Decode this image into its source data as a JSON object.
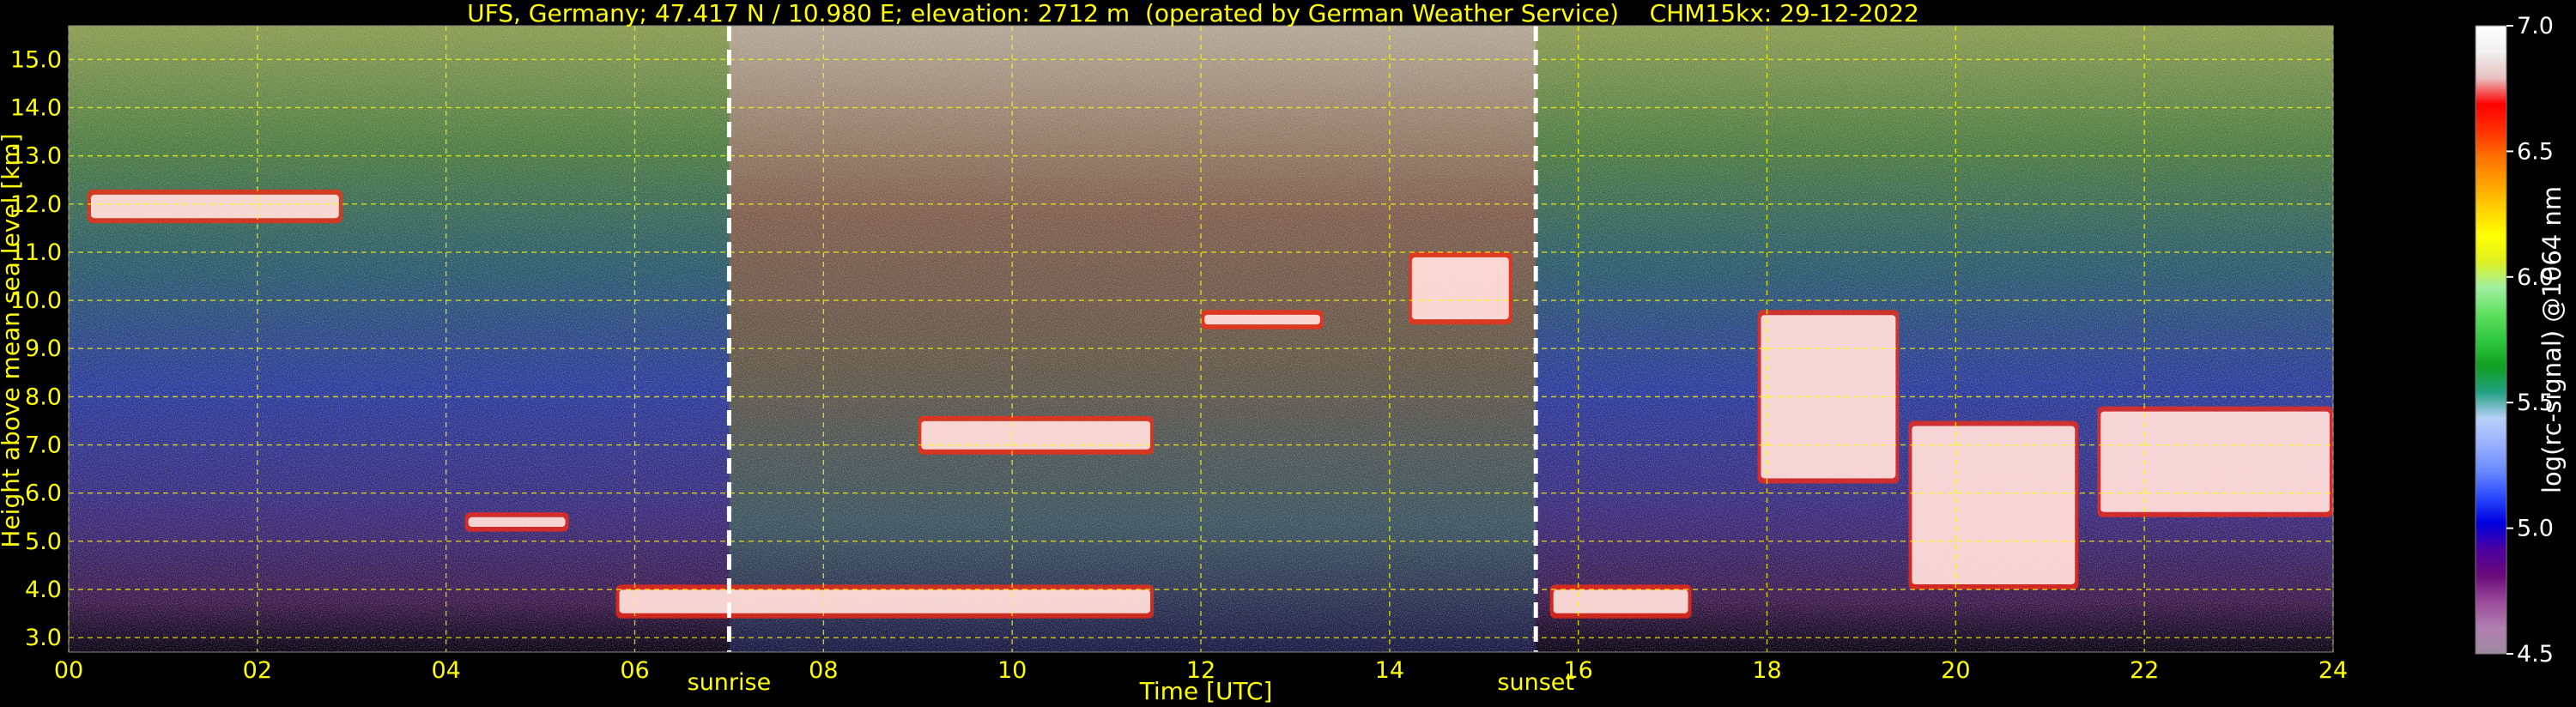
{
  "chart_data": {
    "type": "heatmap",
    "title": "UFS, Germany; 47.417 N / 10.980 E; elevation: 2712 m  (operated by German Weather Service)    CHM15kx: 29-12-2022",
    "xlabel": "Time [UTC]",
    "ylabel": "Height above mean sea level [km]",
    "xlim": [
      0,
      24
    ],
    "ylim": [
      2.7,
      15.7
    ],
    "x_ticks": [
      "00",
      "02",
      "04",
      "06",
      "08",
      "10",
      "12",
      "14",
      "16",
      "18",
      "20",
      "22",
      "24"
    ],
    "y_ticks": [
      "3.0",
      "4.0",
      "5.0",
      "6.0",
      "7.0",
      "8.0",
      "9.0",
      "10.0",
      "11.0",
      "12.0",
      "13.0",
      "14.0",
      "15.0"
    ],
    "grid": true,
    "colorbar": {
      "label": "log(rc-signal) @1064 nm",
      "range": [
        4.5,
        7.0
      ],
      "ticks": [
        "4.5",
        "5.0",
        "5.5",
        "6.0",
        "6.5",
        "7.0"
      ]
    },
    "markers": [
      {
        "label": "sunrise",
        "x": 7.0
      },
      {
        "label": "sunset",
        "x": 15.55
      }
    ],
    "features": [
      {
        "desc": "cloud layer",
        "t_start": 0.2,
        "t_end": 2.9,
        "h_low": 11.6,
        "h_high": 12.3
      },
      {
        "desc": "cloud layer",
        "t_start": 4.2,
        "t_end": 5.3,
        "h_low": 5.2,
        "h_high": 5.6
      },
      {
        "desc": "low cloud layer",
        "t_start": 5.8,
        "t_end": 11.5,
        "h_low": 3.4,
        "h_high": 4.1
      },
      {
        "desc": "mid cloud",
        "t_start": 9.0,
        "t_end": 11.5,
        "h_low": 6.8,
        "h_high": 7.6
      },
      {
        "desc": "high cloud",
        "t_start": 12.0,
        "t_end": 13.3,
        "h_low": 9.4,
        "h_high": 9.8
      },
      {
        "desc": "high cloud",
        "t_start": 14.2,
        "t_end": 15.3,
        "h_low": 9.5,
        "h_high": 11.0
      },
      {
        "desc": "low cloud layer",
        "t_start": 15.7,
        "t_end": 17.2,
        "h_low": 3.4,
        "h_high": 4.1
      },
      {
        "desc": "deep cloud",
        "t_start": 17.9,
        "t_end": 19.4,
        "h_low": 6.2,
        "h_high": 9.8
      },
      {
        "desc": "deep cloud",
        "t_start": 19.5,
        "t_end": 21.3,
        "h_low": 4.0,
        "h_high": 7.5
      },
      {
        "desc": "cloud layer",
        "t_start": 21.5,
        "t_end": 24.0,
        "h_low": 5.5,
        "h_high": 7.8
      }
    ]
  },
  "colors": {
    "axis_text": "#ffff00",
    "colorbar_text": "#ffffff",
    "background": "#000000",
    "colorbar_stops": [
      "#9e8a9e",
      "#b07fb0",
      "#9a4a9a",
      "#6a0a7a",
      "#4a00a0",
      "#0000e0",
      "#2a4aff",
      "#6a8aff",
      "#9ab0ff",
      "#b8d0f8",
      "#20a080",
      "#10a020",
      "#30c840",
      "#60e060",
      "#a0f0a0",
      "#e0f020",
      "#ffff00",
      "#ffd000",
      "#ffa000",
      "#ff7000",
      "#ff3000",
      "#ff0000",
      "#e8c0c0",
      "#f0f0f0",
      "#ffffff"
    ]
  }
}
